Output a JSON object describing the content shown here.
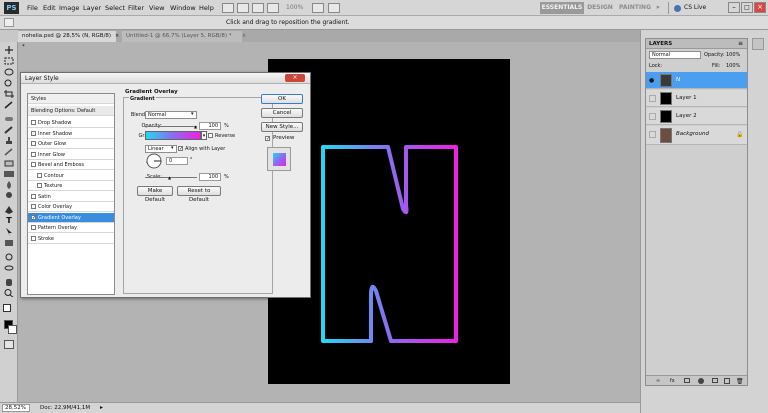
{
  "app": {
    "logo": "PS",
    "zoom": "100%",
    "workspace_active": "ESSENTIALS",
    "workspace_2": "DESIGN",
    "workspace_3": "PAINTING",
    "cs_live": "CS Live"
  },
  "menu": [
    "File",
    "Edit",
    "Image",
    "Layer",
    "Select",
    "Filter",
    "View",
    "Window",
    "Help"
  ],
  "options_bar": {
    "hint": "Click and drag to reposition the gradient."
  },
  "tabs": [
    {
      "label": "nohelia.psd @ 28,5% (N, RGB/8) *",
      "active": true
    },
    {
      "label": "Untitled-1 @ 66,7% (Layer 5, RGB/8) *",
      "active": false
    }
  ],
  "status": {
    "zoom": "28,52%",
    "doc": "Doc: 22,9M/41,1M"
  },
  "layers_panel": {
    "title": "LAYERS",
    "blend": "Normal",
    "opacity_label": "Opacity:",
    "opacity": "100%",
    "lock_label": "Lock:",
    "fill_label": "Fill:",
    "fill": "100%",
    "layers": [
      {
        "name": "N",
        "selected": true
      },
      {
        "name": "Layer 1",
        "selected": false
      },
      {
        "name": "Layer 2",
        "selected": false
      },
      {
        "name": "Background",
        "selected": false
      }
    ]
  },
  "dialog": {
    "title": "Layer Style",
    "styles_header": "Styles",
    "blending_options": "Blending Options: Default",
    "items": [
      {
        "label": "Drop Shadow",
        "checked": false,
        "indent": false,
        "selected": false
      },
      {
        "label": "Inner Shadow",
        "checked": false,
        "indent": false,
        "selected": false
      },
      {
        "label": "Outer Glow",
        "checked": false,
        "indent": false,
        "selected": false
      },
      {
        "label": "Inner Glow",
        "checked": false,
        "indent": false,
        "selected": false
      },
      {
        "label": "Bevel and Emboss",
        "checked": false,
        "indent": false,
        "selected": false
      },
      {
        "label": "Contour",
        "checked": false,
        "indent": true,
        "selected": false
      },
      {
        "label": "Texture",
        "checked": false,
        "indent": true,
        "selected": false
      },
      {
        "label": "Satin",
        "checked": false,
        "indent": false,
        "selected": false
      },
      {
        "label": "Color Overlay",
        "checked": false,
        "indent": false,
        "selected": false
      },
      {
        "label": "Gradient Overlay",
        "checked": true,
        "indent": false,
        "selected": true
      },
      {
        "label": "Pattern Overlay",
        "checked": false,
        "indent": false,
        "selected": false
      },
      {
        "label": "Stroke",
        "checked": false,
        "indent": false,
        "selected": false
      }
    ],
    "section_title": "Gradient Overlay",
    "group_title": "Gradient",
    "blend_mode_label": "Blend Mode:",
    "blend_mode": "Normal",
    "opacity_label": "Opacity:",
    "opacity": "100",
    "opacity_unit": "%",
    "opacity_level": 1.0,
    "gradient_label": "Gradient:",
    "reverse_label": "Reverse",
    "style_label": "Style:",
    "style": "Linear",
    "align_label": "Align with Layer",
    "angle_label": "Angle:",
    "angle": "0",
    "angle_unit": "°",
    "scale_label": "Scale:",
    "scale": "100",
    "scale_unit": "%",
    "scale_level": 0.5,
    "make_default": "Make Default",
    "reset_default": "Reset to Default",
    "ok": "OK",
    "cancel": "Cancel",
    "new_style": "New Style...",
    "preview": "Preview"
  },
  "colors": {
    "cyan": "#22d8f5",
    "violet": "#8a6cf0",
    "magenta": "#f020e6",
    "selection": "#4b9ff0"
  }
}
